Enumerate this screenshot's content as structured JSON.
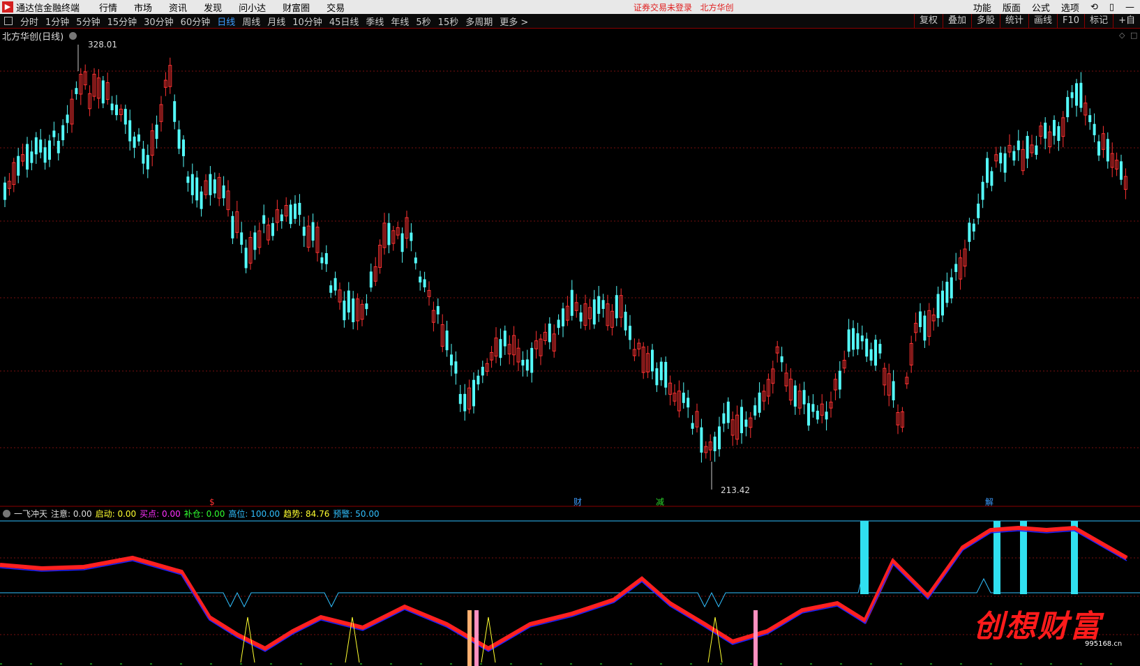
{
  "menubar": {
    "app_name": "通达信金融终端",
    "items": [
      "行情",
      "市场",
      "资讯",
      "发现",
      "问小达",
      "财富圈",
      "交易"
    ],
    "notice": "证券交易未登录",
    "stock_short": "北方华创",
    "right": [
      "功能",
      "版面",
      "公式",
      "选项"
    ]
  },
  "periods": [
    "分时",
    "1分钟",
    "5分钟",
    "15分钟",
    "30分钟",
    "60分钟",
    "日线",
    "周线",
    "月线",
    "10分钟",
    "45日线",
    "季线",
    "年线",
    "5秒",
    "15秒",
    "多周期",
    "更多 >"
  ],
  "active_period": "日线",
  "tools": [
    "复权",
    "叠加",
    "多股",
    "统计",
    "画线",
    "F10",
    "标记",
    "+自"
  ],
  "stock_title": "北方华创(日线)",
  "price_high_label": "328.01",
  "price_low_label": "213.42",
  "event_markers": [
    {
      "text": "$",
      "color": "#ff3030"
    },
    {
      "text": "财",
      "color": "#3c9cff"
    },
    {
      "text": "减",
      "color": "#2bd62b"
    },
    {
      "text": "解",
      "color": "#3c9cff"
    }
  ],
  "indicator": {
    "name": "一飞冲天",
    "fields": [
      {
        "label": "注意:",
        "value": "0.00",
        "color": "#dddddd"
      },
      {
        "label": "启动:",
        "value": "0.00",
        "color": "#ffff30"
      },
      {
        "label": "买点:",
        "value": "0.00",
        "color": "#ff30ff"
      },
      {
        "label": "补仓:",
        "value": "0.00",
        "color": "#30ff30"
      },
      {
        "label": "高位:",
        "value": "100.00",
        "color": "#30c0ff"
      },
      {
        "label": "趋势:",
        "value": "84.76",
        "color": "#ffff30"
      },
      {
        "label": "预警:",
        "value": "50.00",
        "color": "#30c0ff"
      }
    ]
  },
  "watermark": "创想财富",
  "watermark_url": "995168.cn",
  "colors": {
    "up": "#ff3232",
    "down": "#54fcfc",
    "grid": "#7a1010"
  }
}
